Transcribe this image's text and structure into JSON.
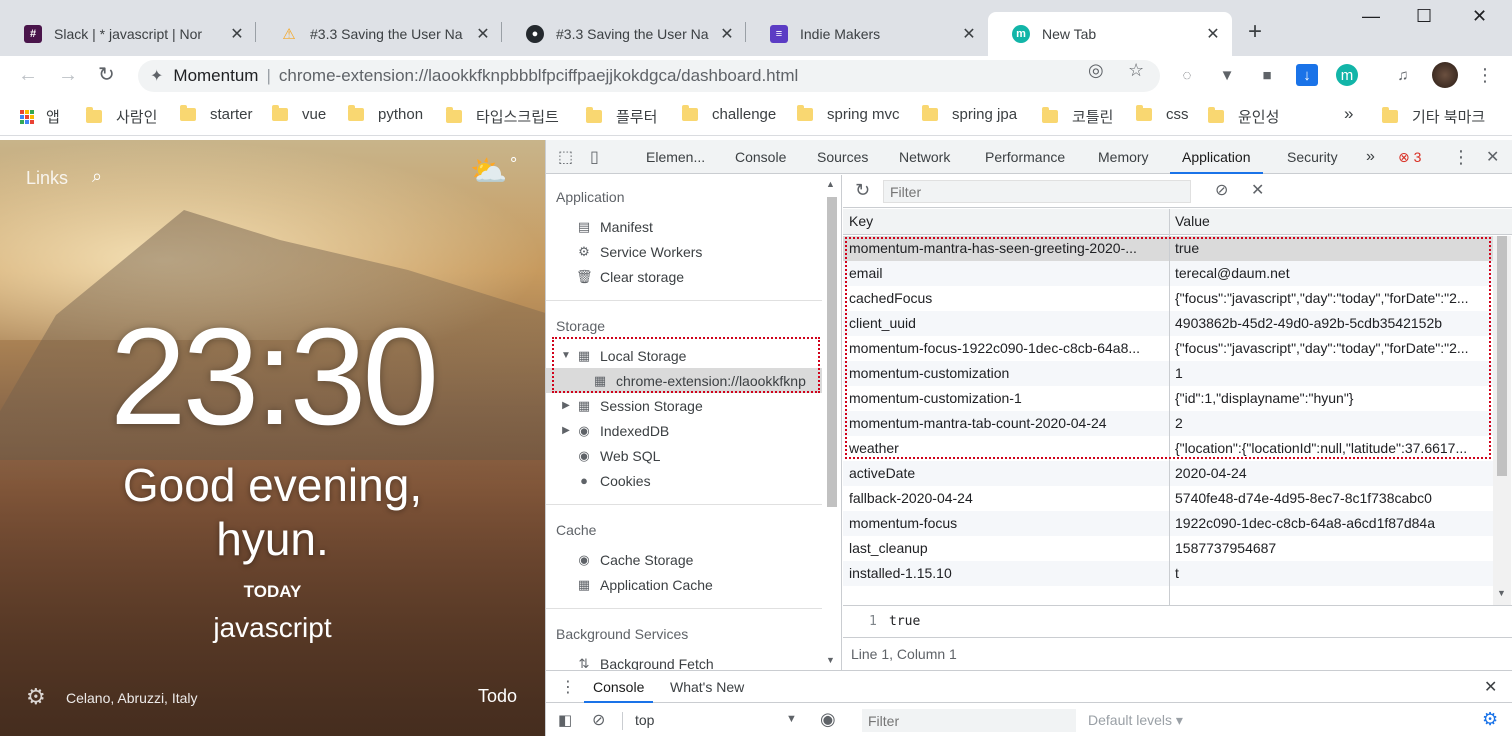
{
  "tabs": [
    {
      "title": "Slack | * javascript | Nor",
      "icon": "slack-icon",
      "color": "#4a154b"
    },
    {
      "title": "#3.3 Saving the User Na",
      "icon": "nomad-icon",
      "color": "#f5a623"
    },
    {
      "title": "#3.3 Saving the User Na",
      "icon": "github-icon",
      "color": "#24292e"
    },
    {
      "title": "Indie Makers",
      "icon": "indie-makers-icon",
      "color": "#5b3cc4"
    },
    {
      "title": "New Tab",
      "icon": "momentum-icon",
      "color": "#12b5a8"
    }
  ],
  "omnibox": {
    "site": "Momentum",
    "url": "chrome-extension://laookkfknpbbblfpciffpaejjkokdgca/dashboard.html"
  },
  "bookmarks": {
    "apps": "앱",
    "items": [
      "사람인",
      "starter",
      "vue",
      "python",
      "타입스크립트",
      "플루터",
      "challenge",
      "spring mvc",
      "spring jpa",
      "코틀린",
      "css",
      "윤인성"
    ],
    "more": "»",
    "other": "기타 북마크"
  },
  "momentum": {
    "links": "Links",
    "degree": "°",
    "time": "23:30",
    "greeting_line1": "Good evening,",
    "greeting_line2": "hyun.",
    "today": "TODAY",
    "focus": "javascript",
    "location": "Celano, Abruzzi, Italy",
    "todo": "Todo"
  },
  "devtools": {
    "tabs": [
      "Elemen...",
      "Console",
      "Sources",
      "Network",
      "Performance",
      "Memory",
      "Application",
      "Security"
    ],
    "active_tab": "Application",
    "more": "»",
    "error_count": "3",
    "sidebar": {
      "application_head": "Application",
      "application_items": [
        "Manifest",
        "Service Workers",
        "Clear storage"
      ],
      "storage_head": "Storage",
      "local_storage": "Local Storage",
      "local_storage_child": "chrome-extension://laookkfknp",
      "storage_items": [
        "Session Storage",
        "IndexedDB",
        "Web SQL",
        "Cookies"
      ],
      "cache_head": "Cache",
      "cache_items": [
        "Cache Storage",
        "Application Cache"
      ],
      "bg_head": "Background Services",
      "bg_items": [
        "Background Fetch"
      ]
    },
    "storage": {
      "filter_placeholder": "Filter",
      "col_key": "Key",
      "col_value": "Value",
      "rows": [
        {
          "key": "momentum-mantra-has-seen-greeting-2020-...",
          "value": "true"
        },
        {
          "key": "email",
          "value": "terecal@daum.net"
        },
        {
          "key": "cachedFocus",
          "value": "{\"focus\":\"javascript\",\"day\":\"today\",\"forDate\":\"2..."
        },
        {
          "key": "client_uuid",
          "value": "4903862b-45d2-49d0-a92b-5cdb3542152b"
        },
        {
          "key": "momentum-focus-1922c090-1dec-c8cb-64a8...",
          "value": "{\"focus\":\"javascript\",\"day\":\"today\",\"forDate\":\"2..."
        },
        {
          "key": "momentum-customization",
          "value": "1"
        },
        {
          "key": "momentum-customization-1",
          "value": "{\"id\":1,\"displayname\":\"hyun\"}"
        },
        {
          "key": "momentum-mantra-tab-count-2020-04-24",
          "value": "2"
        },
        {
          "key": "weather",
          "value": "{\"location\":{\"locationId\":null,\"latitude\":37.6617..."
        },
        {
          "key": "activeDate",
          "value": "2020-04-24"
        },
        {
          "key": "fallback-2020-04-24",
          "value": "5740fe48-d74e-4d95-8ec7-8c1f738cabc0"
        },
        {
          "key": "momentum-focus",
          "value": "1922c090-1dec-c8cb-64a8-a6cd1f87d84a"
        },
        {
          "key": "last_cleanup",
          "value": "1587737954687"
        },
        {
          "key": "installed-1.15.10",
          "value": "t"
        }
      ],
      "preview_line_no": "1",
      "preview_text": "true",
      "status": "Line 1, Column 1"
    },
    "drawer": {
      "tabs": [
        "Console",
        "What's New"
      ],
      "context": "top",
      "filter_placeholder": "Filter",
      "levels": "Default levels ▾"
    }
  }
}
